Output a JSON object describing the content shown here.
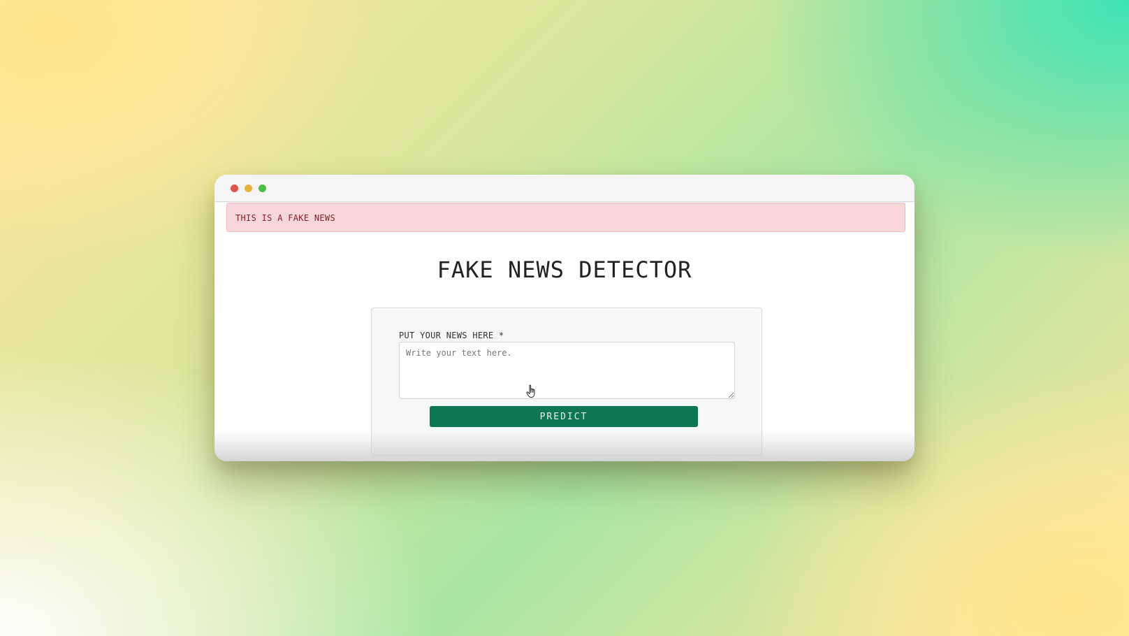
{
  "window": {
    "controls": [
      {
        "name": "close",
        "color": "#e0534d"
      },
      {
        "name": "minimize",
        "color": "#e8b440"
      },
      {
        "name": "maximize",
        "color": "#4fbd45"
      }
    ]
  },
  "alert": {
    "text": "THIS IS A FAKE NEWS",
    "background": "#f8d7da",
    "color": "#842029"
  },
  "page": {
    "title": "FAKE NEWS DETECTOR"
  },
  "form": {
    "label": "PUT YOUR NEWS HERE *",
    "input_value": "",
    "input_placeholder": "Write your text here.",
    "submit_label": "PREDICT",
    "submit_color": "#0e7752"
  },
  "cursor": {
    "icon": "hand-pointer-icon"
  }
}
